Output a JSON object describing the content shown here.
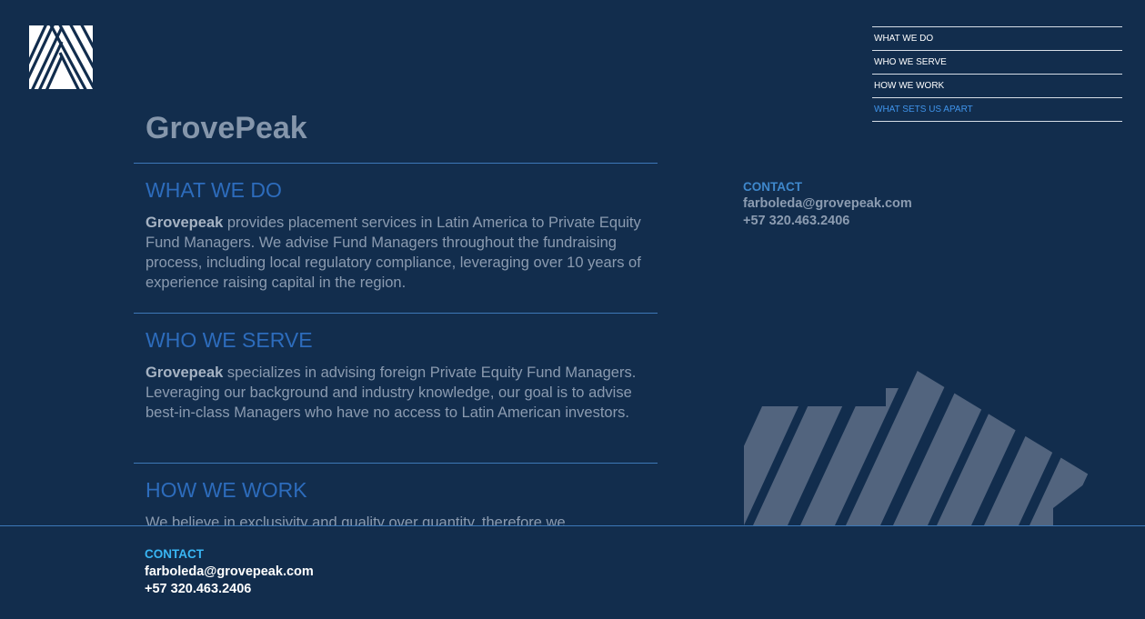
{
  "logo": {
    "icon": "striped-a-logo-icon",
    "color": "#ffffff"
  },
  "nav": {
    "items": [
      {
        "label": "WHAT WE DO",
        "active": false
      },
      {
        "label": "WHO WE SERVE",
        "active": false
      },
      {
        "label": "HOW WE WORK",
        "active": false
      },
      {
        "label": "WHAT SETS US APART",
        "active": true
      }
    ]
  },
  "brand": "GrovePeak",
  "sections": [
    {
      "title": "WHAT WE DO",
      "lead": "Grovepeak",
      "body": " provides placement services in Latin America to Private Equity Fund Managers. We advise Fund Managers throughout the fundraising process, including local regulatory compliance, leveraging over 10 years of experience raising capital in the region."
    },
    {
      "title": "WHO WE SERVE",
      "lead": "Grovepeak",
      "body": " specializes in advising foreign Private Equity Fund Managers. Leveraging our background and industry knowledge, our goal is to advise best-in-class Managers who have no access to Latin American investors."
    },
    {
      "title": "HOW WE WORK",
      "lead": "",
      "body": "We believe in exclusivity and quality over quantity, therefore we"
    }
  ],
  "contact_panel": {
    "label": "CONTACT",
    "email": "farboleda@grovepeak.com",
    "phone": "+57 320.463.2406"
  },
  "footer": {
    "label": "CONTACT",
    "email": "farboleda@grovepeak.com",
    "phone": "+57 320.463.2406"
  },
  "colors": {
    "background": "#122d4d",
    "accent": "#2d6cbc",
    "nav_active": "#3f93ea",
    "footer_label": "#39b6f4",
    "stripes": "#52647e"
  }
}
